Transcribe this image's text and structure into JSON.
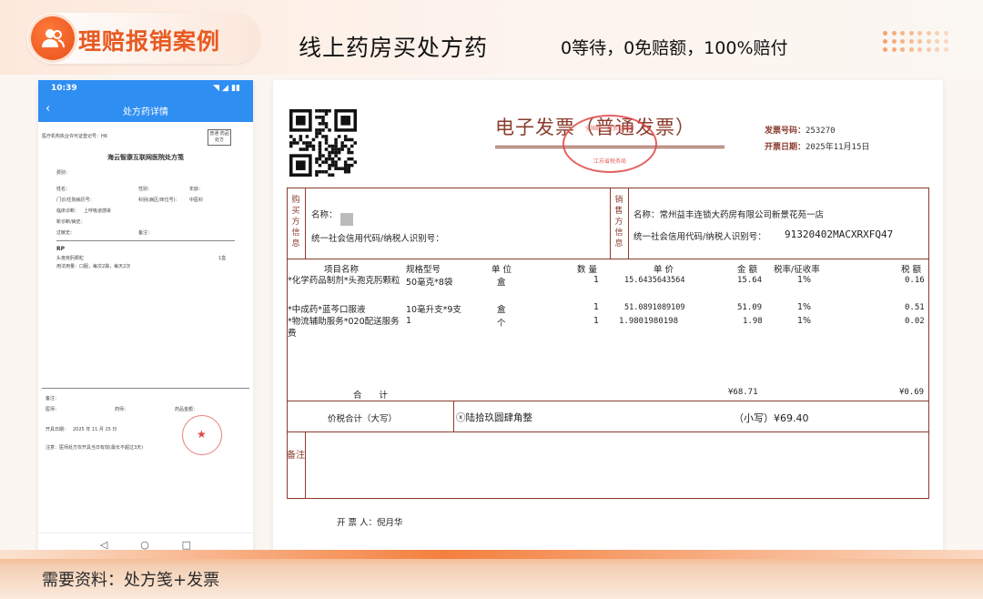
{
  "header": {
    "title": "理赔报销案例",
    "subtitle": "线上药房买处方药",
    "tagline": "0等待，0免赔额，100%赔付",
    "accent": "#e85a22"
  },
  "phone": {
    "status_time": "10:39",
    "status_right": "◥ ◢ ▮▮",
    "nav_title": "处方药详情",
    "doc_org": "医疗机构执业许可证登记号：HK",
    "stamp_label": "普通 药品处方",
    "hospital": "海云智康互联网医院处方笺",
    "fields": [
      "费别：",
      "姓名：",
      "性别：",
      "年龄：",
      "门诊/住院病历号：",
      "科别(病区/床位号)：",
      "临床诊断：",
      "新诊断/病史：",
      "过敏史：",
      "备注：",
      "联系电话："
    ],
    "dept": "中医科",
    "diagnosis": "上呼吸道感染",
    "rp": "RP",
    "drug": "头孢克肟颗粒",
    "drug_usage": "用法用量：口服，每次2袋，每天2次",
    "drug_qty": "1盒",
    "date_label": "开具日期：",
    "date": "2025 年 11 月 15 日",
    "note": "注意：医师处方仅开具当日有效(最长不超过3天)",
    "doctor_label": "医师：",
    "pharm_label": "药师：",
    "amount_label": "药品金额："
  },
  "invoice": {
    "title": "电子发票（普通发票）",
    "number_label": "发票号码：",
    "number": "253270",
    "date_label": "开票日期：",
    "date": "2025年11月15日",
    "seal_top": "全国统一发票监制章",
    "seal_bottom": "江苏省税务局",
    "buyer_label": "购买方信息",
    "seller_label": "销售方信息",
    "buyer_name_label": "名称：",
    "buyer_tax_label": "统一社会信用代码/纳税人识别号：",
    "seller_name": "名称：常州益丰连锁大药房有限公司新景花苑一店",
    "seller_tax_label": "统一社会信用代码/纳税人识别号：",
    "seller_tax": "91320402MACXRXFQ47",
    "cols": [
      "项目名称",
      "规格型号",
      "单 位",
      "数 量",
      "单 价",
      "金 额",
      "税率/征收率",
      "税 额"
    ],
    "items": [
      {
        "name": "*化学药品制剂*头孢克肟颗粒",
        "spec": "50毫克*8袋",
        "unit": "盒",
        "qty": "1",
        "price": "15.6435643564",
        "amount": "15.64",
        "rate": "1%",
        "tax": "0.16"
      },
      {
        "name": "*中成药*蓝芩口服液",
        "spec": "10毫升支*9支",
        "unit": "盒",
        "qty": "1",
        "price": "51.0891089109",
        "amount": "51.09",
        "rate": "1%",
        "tax": "0.51"
      },
      {
        "name": "*物流辅助服务*020配送服务费",
        "spec": "1",
        "unit": "个",
        "qty": "1",
        "price": "1.9801980198",
        "amount": "1.98",
        "rate": "1%",
        "tax": "0.02"
      }
    ],
    "total_label": "合　　计",
    "total_amount": "¥68.71",
    "total_tax": "¥0.69",
    "grand_label": "价税合计（大写）",
    "grand_upper": "ⓧ陆拾玖圆肆角整",
    "grand_small": "（小写）¥69.40",
    "remark_label": "备注",
    "issuer": "开 票 人：倪月华",
    "ink": "#8a3c2c",
    "seal_color": "#e04646"
  },
  "footer": {
    "text": "需要资料：处方笺+发票"
  }
}
